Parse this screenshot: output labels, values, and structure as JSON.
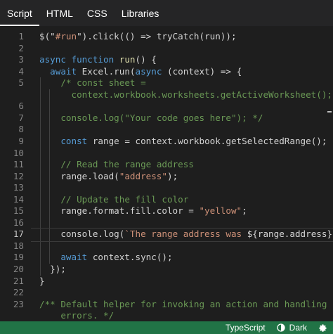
{
  "tabs": [
    "Script",
    "HTML",
    "CSS",
    "Libraries"
  ],
  "active_tab": "Script",
  "code_lines": [
    {
      "n": "1",
      "tokens": [
        [
          "pl",
          "$(\""
        ],
        [
          "str",
          "#run"
        ],
        [
          "pl",
          "\").click(() => tryCatch(run));"
        ]
      ]
    },
    {
      "n": "2",
      "tokens": []
    },
    {
      "n": "3",
      "tokens": [
        [
          "kw",
          "async function "
        ],
        [
          "fn",
          "run"
        ],
        [
          "pl",
          "() {"
        ]
      ]
    },
    {
      "n": "4",
      "tokens": [
        [
          "pl",
          "  "
        ],
        [
          "kw",
          "await "
        ],
        [
          "pl",
          "Excel.run("
        ],
        [
          "kw",
          "async "
        ],
        [
          "pl",
          "(context) => {"
        ]
      ]
    },
    {
      "n": "5",
      "tokens": [
        [
          "pl",
          "    "
        ],
        [
          "cm",
          "/* const sheet ="
        ]
      ]
    },
    {
      "n": "",
      "tokens": [
        [
          "cm",
          "      context.workbook.worksheets.getActiveWorksheet();"
        ]
      ]
    },
    {
      "n": "6",
      "tokens": []
    },
    {
      "n": "7",
      "tokens": [
        [
          "pl",
          "    "
        ],
        [
          "cm",
          "console.log(\"Your code goes here\"); */"
        ]
      ]
    },
    {
      "n": "8",
      "tokens": []
    },
    {
      "n": "9",
      "tokens": [
        [
          "pl",
          "    "
        ],
        [
          "kw",
          "const "
        ],
        [
          "pl",
          "range = context.workbook.getSelectedRange();"
        ]
      ]
    },
    {
      "n": "10",
      "tokens": []
    },
    {
      "n": "11",
      "tokens": [
        [
          "pl",
          "    "
        ],
        [
          "cm",
          "// Read the range address"
        ]
      ]
    },
    {
      "n": "12",
      "tokens": [
        [
          "pl",
          "    range.load("
        ],
        [
          "str",
          "\"address\""
        ],
        [
          "pl",
          ");"
        ]
      ]
    },
    {
      "n": "13",
      "tokens": []
    },
    {
      "n": "14",
      "tokens": [
        [
          "pl",
          "    "
        ],
        [
          "cm",
          "// Update the fill color"
        ]
      ]
    },
    {
      "n": "15",
      "tokens": [
        [
          "pl",
          "    range.format.fill.color = "
        ],
        [
          "str",
          "\"yellow\""
        ],
        [
          "pl",
          ";"
        ]
      ]
    },
    {
      "n": "16",
      "tokens": []
    },
    {
      "n": "17",
      "tokens": [
        [
          "pl",
          "    console.log("
        ],
        [
          "str",
          "`The range address was "
        ],
        [
          "pl",
          "${range.address}"
        ],
        [
          "str",
          ".`"
        ],
        [
          "pl",
          ");"
        ]
      ]
    },
    {
      "n": "18",
      "tokens": []
    },
    {
      "n": "19",
      "tokens": [
        [
          "pl",
          "    "
        ],
        [
          "kw",
          "await "
        ],
        [
          "pl",
          "context.sync();"
        ]
      ]
    },
    {
      "n": "20",
      "tokens": [
        [
          "pl",
          "  });"
        ]
      ]
    },
    {
      "n": "21",
      "tokens": [
        [
          "pl",
          "}"
        ]
      ]
    },
    {
      "n": "22",
      "tokens": []
    },
    {
      "n": "23",
      "tokens": [
        [
          "cm",
          "/** Default helper for invoking an action and handling"
        ]
      ]
    },
    {
      "n": "",
      "tokens": [
        [
          "cm",
          "    errors. */"
        ]
      ]
    }
  ],
  "current_line": "17",
  "status": {
    "language": "TypeScript",
    "theme": "Dark"
  },
  "colors": {
    "accent": "#217346",
    "editor_bg": "#1e1e1e",
    "keyword": "#569cd6",
    "string": "#ce9178",
    "comment": "#6a9955"
  },
  "icons": {
    "theme": "theme-contrast-icon",
    "settings": "gear-icon"
  }
}
